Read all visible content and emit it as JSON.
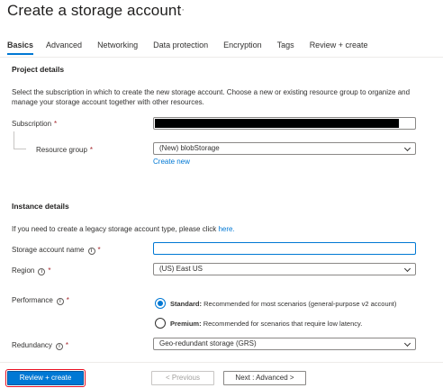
{
  "header": {
    "title": "Create a storage account",
    "more": "···"
  },
  "tabs": [
    "Basics",
    "Advanced",
    "Networking",
    "Data protection",
    "Encryption",
    "Tags",
    "Review + create"
  ],
  "project": {
    "heading": "Project details",
    "description_line1": "Select the subscription in which to create the new storage account. Choose a new or existing resource group to organize and",
    "description_line2": "manage your storage account together with other resources.",
    "subscription_label": "Subscription",
    "resource_group_label": "Resource group",
    "resource_group_value": "(New) blobStorage",
    "create_new": "Create new"
  },
  "instance": {
    "heading": "Instance details",
    "legacy_text": "If you need to create a legacy storage account type, please click",
    "legacy_link": "here.",
    "name_label": "Storage account name",
    "name_value": "",
    "region_label": "Region",
    "region_value": "(US) East US",
    "performance_label": "Performance",
    "standard_bold": "Standard:",
    "standard_text": "Recommended for most scenarios (general-purpose v2 account)",
    "premium_bold": "Premium:",
    "premium_text": "Recommended for scenarios that require low latency.",
    "redundancy_label": "Redundancy",
    "redundancy_value": "Geo-redundant storage (GRS)",
    "selected_performance": "Standard"
  },
  "footer": {
    "review_create": "Review + create",
    "previous": "< Previous",
    "next": "Next : Advanced >"
  },
  "colors": {
    "accent": "#0078d4",
    "required": "#a4262c"
  }
}
